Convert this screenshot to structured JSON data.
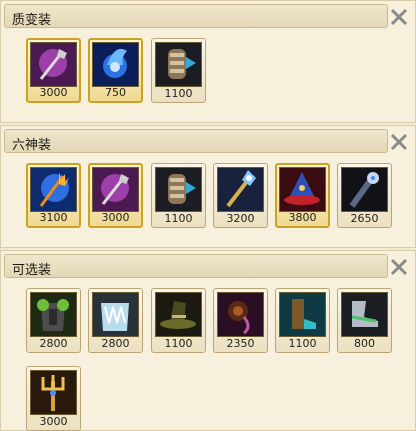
{
  "sections": [
    {
      "title": "质变装",
      "items": [
        {
          "icon": "purple-spiked-mace-icon",
          "price": "3000",
          "highlight": true
        },
        {
          "icon": "blue-flame-orb-icon",
          "price": "750",
          "highlight": true
        },
        {
          "icon": "iron-gauntlet-icon",
          "price": "1100",
          "highlight": false
        }
      ]
    },
    {
      "title": "六神装",
      "items": [
        {
          "icon": "flame-trident-staff-icon",
          "price": "3100",
          "highlight": true
        },
        {
          "icon": "purple-spiked-mace-icon",
          "price": "3000",
          "highlight": true
        },
        {
          "icon": "iron-gauntlet-icon",
          "price": "1100",
          "highlight": false
        },
        {
          "icon": "crystal-scepter-icon",
          "price": "3200",
          "highlight": false
        },
        {
          "icon": "red-wizard-hat-icon",
          "price": "3800",
          "highlight": true
        },
        {
          "icon": "dark-gem-staff-icon",
          "price": "2650",
          "highlight": false
        }
      ]
    },
    {
      "title": "可选装",
      "items": [
        {
          "icon": "green-spiked-armor-icon",
          "price": "2800",
          "highlight": false
        },
        {
          "icon": "frost-plate-armor-icon",
          "price": "2800",
          "highlight": false
        },
        {
          "icon": "dark-witch-hat-icon",
          "price": "1100",
          "highlight": false
        },
        {
          "icon": "dark-orb-amulet-icon",
          "price": "2350",
          "highlight": false
        },
        {
          "icon": "teal-boots-icon",
          "price": "1100",
          "highlight": false
        },
        {
          "icon": "silver-boots-icon",
          "price": "800",
          "highlight": false
        },
        {
          "icon": "golden-trident-icon",
          "price": "3000",
          "highlight": false
        }
      ]
    }
  ],
  "colors": {
    "gold_border": "#c9a227",
    "panel_bg": "#f7f0dc",
    "close_icon": "#8a8a8a"
  }
}
